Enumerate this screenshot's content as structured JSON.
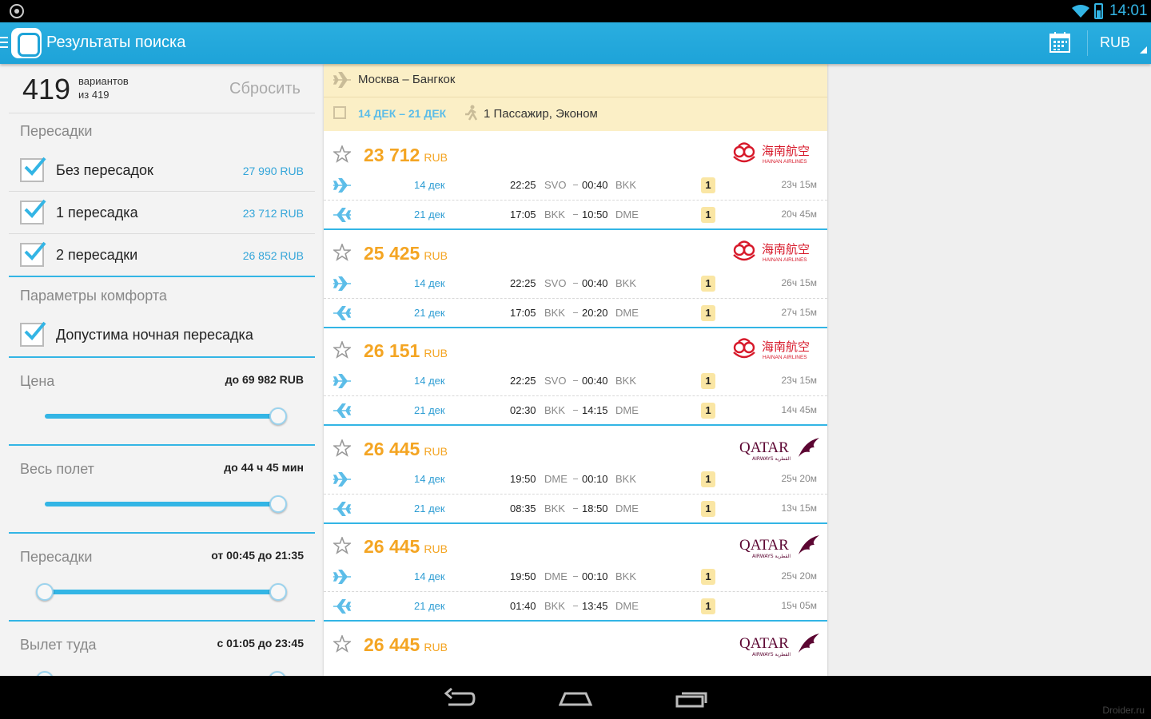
{
  "status_bar": {
    "time": "14:01"
  },
  "app": {
    "title": "Результаты поиска",
    "currency": "RUB"
  },
  "filters": {
    "count": "419",
    "count_line1": "вариантов",
    "count_line2": "из 419",
    "reset_label": "Сбросить",
    "stops_section": "Пересадки",
    "stops_options": [
      {
        "label": "Без пересадок",
        "price": "27 990 RUB",
        "checked": true
      },
      {
        "label": "1 пересадка",
        "price": "23 712 RUB",
        "checked": true
      },
      {
        "label": "2 пересадки",
        "price": "26 852 RUB",
        "checked": true
      }
    ],
    "comfort_section": "Параметры комфорта",
    "comfort_option": {
      "label": "Допустима ночная пересадка",
      "checked": true
    },
    "price": {
      "label": "Цена",
      "value": "до 69 982 RUB",
      "level": 1.0
    },
    "duration": {
      "label": "Весь полет",
      "value": "до 44 ч 45 мин",
      "level": 1.0
    },
    "layovers": {
      "label": "Пересадки",
      "value": "от 00:45 до 21:35",
      "range": [
        0.0,
        1.0
      ]
    },
    "departure": {
      "label": "Вылет туда",
      "value": "с 01:05 до 23:45"
    }
  },
  "search": {
    "route": "Москва – Бангкок",
    "dates": "14 ДЕК – 21 ДЕК",
    "passengers": "1 Пассажир, Эконом"
  },
  "results": [
    {
      "price": "23 712",
      "currency": "RUB",
      "airline": "hainan",
      "legs": [
        {
          "date": "14 дек",
          "dep_time": "22:25",
          "dep_code": "SVO",
          "arr_time": "00:40",
          "arr_code": "BKK",
          "stops": "1",
          "duration": "23ч 15м"
        },
        {
          "date": "21 дек",
          "dep_time": "17:05",
          "dep_code": "BKK",
          "arr_time": "10:50",
          "arr_code": "DME",
          "stops": "1",
          "duration": "20ч 45м"
        }
      ]
    },
    {
      "price": "25 425",
      "currency": "RUB",
      "airline": "hainan",
      "legs": [
        {
          "date": "14 дек",
          "dep_time": "22:25",
          "dep_code": "SVO",
          "arr_time": "00:40",
          "arr_code": "BKK",
          "stops": "1",
          "duration": "26ч 15м"
        },
        {
          "date": "21 дек",
          "dep_time": "17:05",
          "dep_code": "BKK",
          "arr_time": "20:20",
          "arr_code": "DME",
          "stops": "1",
          "duration": "27ч 15м"
        }
      ]
    },
    {
      "price": "26 151",
      "currency": "RUB",
      "airline": "hainan",
      "legs": [
        {
          "date": "14 дек",
          "dep_time": "22:25",
          "dep_code": "SVO",
          "arr_time": "00:40",
          "arr_code": "BKK",
          "stops": "1",
          "duration": "23ч 15м"
        },
        {
          "date": "21 дек",
          "dep_time": "02:30",
          "dep_code": "BKK",
          "arr_time": "14:15",
          "arr_code": "DME",
          "stops": "1",
          "duration": "14ч 45м"
        }
      ]
    },
    {
      "price": "26 445",
      "currency": "RUB",
      "airline": "qatar",
      "legs": [
        {
          "date": "14 дек",
          "dep_time": "19:50",
          "dep_code": "DME",
          "arr_time": "00:10",
          "arr_code": "BKK",
          "stops": "1",
          "duration": "25ч 20м"
        },
        {
          "date": "21 дек",
          "dep_time": "08:35",
          "dep_code": "BKK",
          "arr_time": "18:50",
          "arr_code": "DME",
          "stops": "1",
          "duration": "13ч 15м"
        }
      ]
    },
    {
      "price": "26 445",
      "currency": "RUB",
      "airline": "qatar",
      "legs": [
        {
          "date": "14 дек",
          "dep_time": "19:50",
          "dep_code": "DME",
          "arr_time": "00:10",
          "arr_code": "BKK",
          "stops": "1",
          "duration": "25ч 20м"
        },
        {
          "date": "21 дек",
          "dep_time": "01:40",
          "dep_code": "BKK",
          "arr_time": "13:45",
          "arr_code": "DME",
          "stops": "1",
          "duration": "15ч 05м"
        }
      ]
    },
    {
      "price": "26 445",
      "currency": "RUB",
      "airline": "qatar",
      "legs": []
    }
  ],
  "airline_logos": {
    "hainan": {
      "cn": "海南航空",
      "en": "HAINAN AIRLINES",
      "color": "#d7192a"
    },
    "qatar": {
      "name": "QATAR",
      "sub": "AIRWAYS القطرية",
      "color": "#5c0632"
    }
  },
  "watermark": "Droider.ru",
  "colors": {
    "accent": "#33b5e5",
    "price": "#f4a523",
    "header_bg": "#fbefc6"
  }
}
